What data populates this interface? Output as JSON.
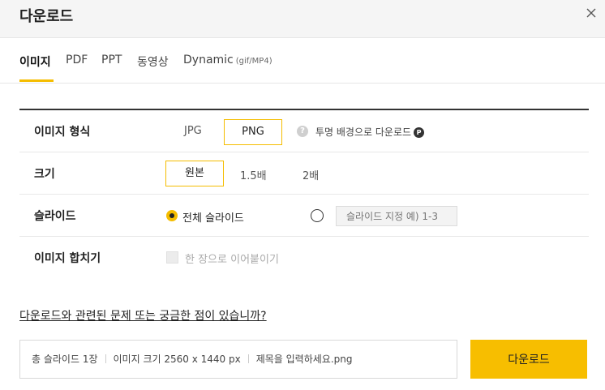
{
  "header": {
    "title": "다운로드"
  },
  "tabs": [
    {
      "label": "이미지",
      "active": true
    },
    {
      "label": "PDF"
    },
    {
      "label": "PPT"
    },
    {
      "label": "동영상"
    },
    {
      "label": "Dynamic",
      "sub": "(gif/MP4)"
    }
  ],
  "rows": {
    "format": {
      "label": "이미지 형식",
      "options": [
        "JPG",
        "PNG"
      ],
      "selected": "PNG",
      "help_text": "투명 배경으로 다운로드",
      "badge": "P"
    },
    "size": {
      "label": "크기",
      "options": [
        "원본",
        "1.5배",
        "2배"
      ],
      "selected": "원본"
    },
    "slides": {
      "label": "슬라이드",
      "all_label": "전체 슬라이드",
      "range_placeholder": "슬라이드 지정 예) 1-3"
    },
    "merge": {
      "label": "이미지 합치기",
      "checkbox_label": "한 장으로 이어붙이기"
    }
  },
  "faq_link": "다운로드와 관련된 문제 또는 궁금한 점이 있습니까?",
  "info": {
    "count": "총 슬라이드 1장",
    "dimensions": "이미지 크기 2560 x 1440 px",
    "filename": "제목을 입력하세요.png"
  },
  "download_button": "다운로드",
  "colors": {
    "accent": "#f7be00",
    "border_dark": "#333333"
  }
}
